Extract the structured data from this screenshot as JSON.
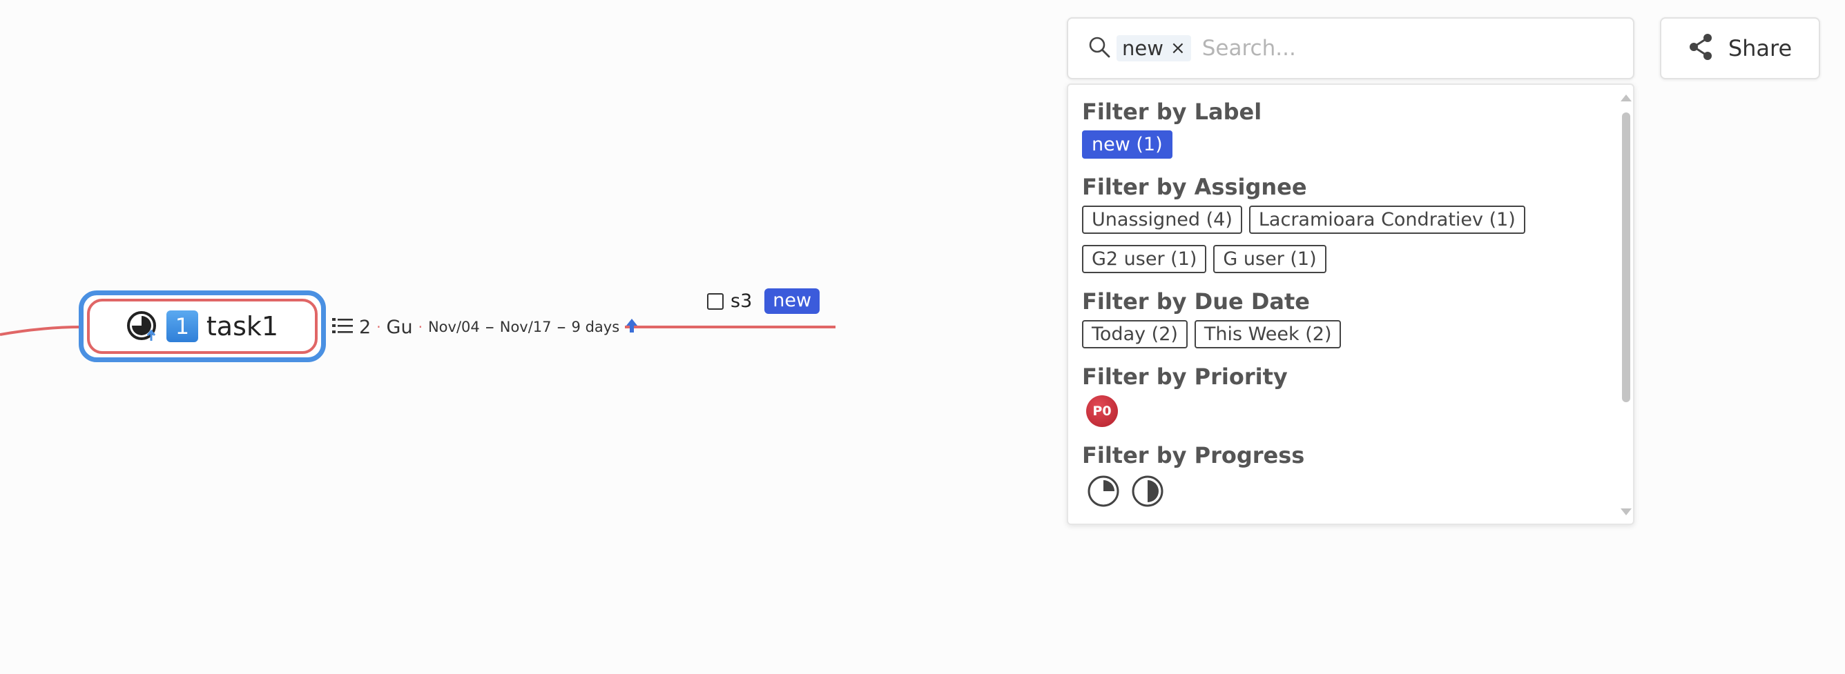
{
  "search": {
    "chip_label": "new",
    "chip_remove": "×",
    "placeholder": "Search..."
  },
  "share": {
    "label": "Share",
    "icon": "share-icon"
  },
  "filters": {
    "label": {
      "title": "Filter by Label",
      "tags": [
        {
          "text": "new (1)",
          "active": true
        }
      ]
    },
    "assignee": {
      "title": "Filter by Assignee",
      "tags": [
        "Unassigned (4)",
        "Lacramioara Condratiev (1)",
        "G2 user (1)",
        "G user (1)"
      ]
    },
    "due_date": {
      "title": "Filter by Due Date",
      "tags": [
        "Today (2)",
        "This Week (2)"
      ]
    },
    "priority": {
      "title": "Filter by Priority",
      "badge": "P0",
      "color": "#c62832"
    },
    "progress": {
      "title": "Filter by Progress"
    }
  },
  "task": {
    "number": "1",
    "title": "task1",
    "subtask_count": "2",
    "assignee": "Gu",
    "start_date": "Nov/04",
    "end_date": "Nov/17",
    "duration": "9 days",
    "priority_icon": "arrow-up-icon"
  },
  "subtask": {
    "title": "s3",
    "label": "new"
  },
  "colors": {
    "accent": "#3b5bdb",
    "node_border": "#4a90e2",
    "branch": "#e06666"
  }
}
